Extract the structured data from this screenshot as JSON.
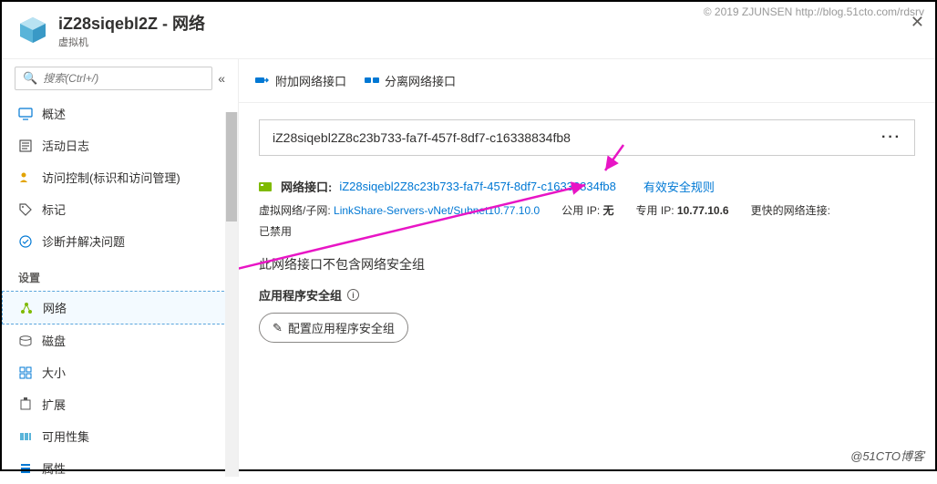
{
  "watermark_top": "© 2019 ZJUNSEN http://blog.51cto.com/rdsrv",
  "watermark_bottom": "@51CTO博客",
  "header": {
    "title": "iZ28siqebl2Z - 网络",
    "subtitle": "虚拟机"
  },
  "sidebar": {
    "search_placeholder": "搜索(Ctrl+/)",
    "items": [
      {
        "label": "概述",
        "icon": "monitor-icon"
      },
      {
        "label": "活动日志",
        "icon": "activity-log-icon"
      },
      {
        "label": "访问控制(标识和访问管理)",
        "icon": "access-control-icon"
      },
      {
        "label": "标记",
        "icon": "tag-icon"
      },
      {
        "label": "诊断并解决问题",
        "icon": "diagnose-icon"
      }
    ],
    "section_label": "设置",
    "settings_items": [
      {
        "label": "网络",
        "icon": "network-icon",
        "active": true
      },
      {
        "label": "磁盘",
        "icon": "disk-icon"
      },
      {
        "label": "大小",
        "icon": "size-icon"
      },
      {
        "label": "扩展",
        "icon": "extensions-icon"
      },
      {
        "label": "可用性集",
        "icon": "availability-set-icon"
      },
      {
        "label": "属性",
        "icon": "properties-icon"
      }
    ]
  },
  "toolbar": {
    "attach_label": "附加网络接口",
    "detach_label": "分离网络接口"
  },
  "content": {
    "id_value": "iZ28siqebl2Z8c23b733-fa7f-457f-8df7-c16338834fb8",
    "ni_label": "网络接口:",
    "ni_value": "iZ28siqebl2Z8c23b733-fa7f-457f-8df7-c16338834fb8",
    "rules_link": "有效安全规则",
    "vnet_label": "虚拟网络/子网:",
    "vnet_value": "LinkShare-Servers-vNet/Subnet10.77.10.0",
    "public_ip_label": "公用 IP:",
    "public_ip_value": "无",
    "private_ip_label": "专用 IP:",
    "private_ip_value": "10.77.10.6",
    "faster_net_label": "更快的网络连接:",
    "enabled_text": "已禁用",
    "no_nsg_text": "此网络接口不包含网络安全组",
    "asg_label": "应用程序安全组",
    "config_btn": "配置应用程序安全组"
  }
}
